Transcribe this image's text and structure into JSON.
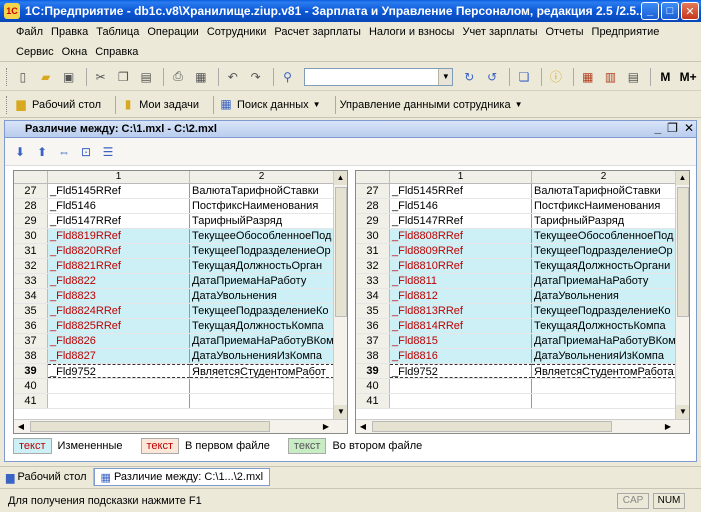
{
  "window": {
    "title": "1С:Предприятие - db1c.v8\\Хранилище.ziup.v81 - Зарплата и Управление Персоналом, редакция 2.5 /2.5...",
    "logo": "1C"
  },
  "menu": {
    "row1": [
      "Файл",
      "Правка",
      "Таблица",
      "Операции",
      "Сотрудники",
      "Расчет зарплаты",
      "Налоги и взносы",
      "Учет зарплаты",
      "Отчеты",
      "Предприятие"
    ],
    "row2": [
      "Сервис",
      "Окна",
      "Справка"
    ]
  },
  "toolbar2": {
    "desktop": "Рабочий стол",
    "tasks": "Мои задачи",
    "search": "Поиск данных",
    "employee": "Управление данными сотрудника"
  },
  "toolbar1": {
    "m": "M",
    "mplus": "M+"
  },
  "child": {
    "title": "Различие между: C:\\1.mxl - C:\\2.mxl"
  },
  "grid_header": {
    "c1": "1",
    "c2": "2"
  },
  "left_rows": [
    {
      "n": "27",
      "a": "_Fld5145RRef",
      "b": "ВалютаТарифнойСтавки",
      "changed": false
    },
    {
      "n": "28",
      "a": "_Fld5146",
      "b": "ПостфиксНаименования",
      "changed": false
    },
    {
      "n": "29",
      "a": "_Fld5147RRef",
      "b": "ТарифныйРазряд",
      "changed": false
    },
    {
      "n": "30",
      "a": "_Fld8819RRef",
      "b": "ТекущееОбособленноеПод",
      "changed": true
    },
    {
      "n": "31",
      "a": "_Fld8820RRef",
      "b": "ТекущееПодразделениеОр",
      "changed": true
    },
    {
      "n": "32",
      "a": "_Fld8821RRef",
      "b": "ТекущаяДолжностьОрган",
      "changed": true
    },
    {
      "n": "33",
      "a": "_Fld8822",
      "b": "ДатаПриемаНаРаботу",
      "changed": true
    },
    {
      "n": "34",
      "a": "_Fld8823",
      "b": "ДатаУвольнения",
      "changed": true
    },
    {
      "n": "35",
      "a": "_Fld8824RRef",
      "b": "ТекущееПодразделениеКо",
      "changed": true
    },
    {
      "n": "36",
      "a": "_Fld8825RRef",
      "b": "ТекущаяДолжностьКомпа",
      "changed": true
    },
    {
      "n": "37",
      "a": "_Fld8826",
      "b": "ДатаПриемаНаРаботуВКом",
      "changed": true
    },
    {
      "n": "38",
      "a": "_Fld8827",
      "b": "ДатаУвольненияИзКомпа",
      "changed": true
    },
    {
      "n": "39",
      "a": "_Fld9752",
      "b": "ЯвляетсяСтудентомРабот",
      "changed": false,
      "current": true
    },
    {
      "n": "40",
      "a": "",
      "b": "",
      "changed": false
    },
    {
      "n": "41",
      "a": "",
      "b": "",
      "changed": false
    }
  ],
  "right_rows": [
    {
      "n": "27",
      "a": "_Fld5145RRef",
      "b": "ВалютаТарифнойСтавки",
      "changed": false
    },
    {
      "n": "28",
      "a": "_Fld5146",
      "b": "ПостфиксНаименования",
      "changed": false
    },
    {
      "n": "29",
      "a": "_Fld5147RRef",
      "b": "ТарифныйРазряд",
      "changed": false
    },
    {
      "n": "30",
      "a": "_Fld8808RRef",
      "b": "ТекущееОбособленноеПод",
      "changed": true
    },
    {
      "n": "31",
      "a": "_Fld8809RRef",
      "b": "ТекущееПодразделениеОр",
      "changed": true
    },
    {
      "n": "32",
      "a": "_Fld8810RRef",
      "b": "ТекущаяДолжностьОргани",
      "changed": true
    },
    {
      "n": "33",
      "a": "_Fld8811",
      "b": "ДатаПриемаНаРаботу",
      "changed": true
    },
    {
      "n": "34",
      "a": "_Fld8812",
      "b": "ДатаУвольнения",
      "changed": true
    },
    {
      "n": "35",
      "a": "_Fld8813RRef",
      "b": "ТекущееПодразделениеКо",
      "changed": true
    },
    {
      "n": "36",
      "a": "_Fld8814RRef",
      "b": "ТекущаяДолжностьКомпа",
      "changed": true
    },
    {
      "n": "37",
      "a": "_Fld8815",
      "b": "ДатаПриемаНаРаботуВКом",
      "changed": true
    },
    {
      "n": "38",
      "a": "_Fld8816",
      "b": "ДатаУвольненияИзКомпа",
      "changed": true
    },
    {
      "n": "39",
      "a": "_Fld9752",
      "b": "ЯвляетсяСтудентомРабота",
      "changed": false,
      "current": true
    },
    {
      "n": "40",
      "a": "",
      "b": "",
      "changed": false
    },
    {
      "n": "41",
      "a": "",
      "b": "",
      "changed": false
    }
  ],
  "legend": {
    "swatch": "текст",
    "changed": "Измененные",
    "first": "В первом файле",
    "second": "Во втором файле"
  },
  "taskbar": {
    "desktop": "Рабочий стол",
    "diff": "Различие между: C:\\1...\\2.mxl"
  },
  "status": {
    "hint": "Для получения подсказки нажмите F1",
    "cap": "CAP",
    "num": "NUM"
  }
}
